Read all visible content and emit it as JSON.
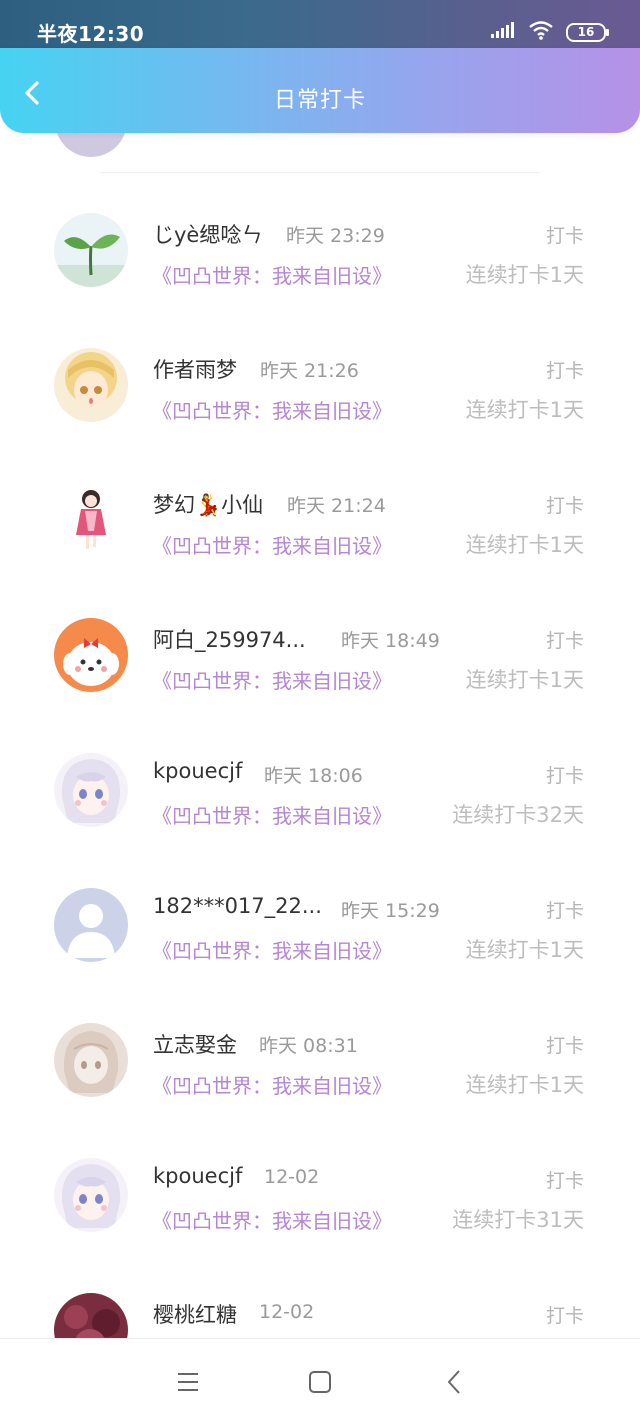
{
  "status_bar": {
    "time": "半夜12:30",
    "battery": "16"
  },
  "header": {
    "title": "日常打卡"
  },
  "items": [
    {
      "name": "じyè缌唸ㄣ",
      "time": "昨天 23:29",
      "action": "打卡",
      "book": "《凹凸世界：我来自旧设》",
      "streak": "连续打卡1天",
      "avatar": "sprout-avatar"
    },
    {
      "name": "作者雨梦",
      "time": "昨天 21:26",
      "action": "打卡",
      "book": "《凹凸世界：我来自旧设》",
      "streak": "连续打卡1天",
      "avatar": "anime-blonde-avatar"
    },
    {
      "name": "梦幻💃小仙",
      "time": "昨天 21:24",
      "action": "打卡",
      "book": "《凹凸世界：我来自旧设》",
      "streak": "连续打卡1天",
      "avatar": "anime-kimono-avatar"
    },
    {
      "name": "阿白_259974...",
      "time": "昨天 18:49",
      "action": "打卡",
      "book": "《凹凸世界：我来自旧设》",
      "streak": "连续打卡1天",
      "avatar": "puppy-avatar"
    },
    {
      "name": "kpouecjf",
      "time": "昨天 18:06",
      "action": "打卡",
      "book": "《凹凸世界：我来自旧设》",
      "streak": "连续打卡32天",
      "avatar": "anime-white-hair-avatar"
    },
    {
      "name": "182***017_22...",
      "time": "昨天 15:29",
      "action": "打卡",
      "book": "《凹凸世界：我来自旧设》",
      "streak": "连续打卡1天",
      "avatar": "default-avatar"
    },
    {
      "name": "立志娶金",
      "time": "昨天 08:31",
      "action": "打卡",
      "book": "《凹凸世界：我来自旧设》",
      "streak": "连续打卡1天",
      "avatar": "sketch-avatar"
    },
    {
      "name": "kpouecjf",
      "time": "12-02",
      "action": "打卡",
      "book": "《凹凸世界：我来自旧设》",
      "streak": "连续打卡31天",
      "avatar": "anime-white-hair-avatar"
    },
    {
      "name": "樱桃红糖",
      "time": "12-02",
      "action": "打卡",
      "book": "",
      "streak": "",
      "avatar": "dark-red-avatar"
    }
  ],
  "colors": {
    "header_start": "#46d3f2",
    "header_end": "#b691e6",
    "book_link": "#b586d6",
    "muted": "#bdbdbd"
  },
  "nav": {
    "icons": [
      "menu-icon",
      "home-square-icon",
      "back-chevron-icon"
    ]
  }
}
